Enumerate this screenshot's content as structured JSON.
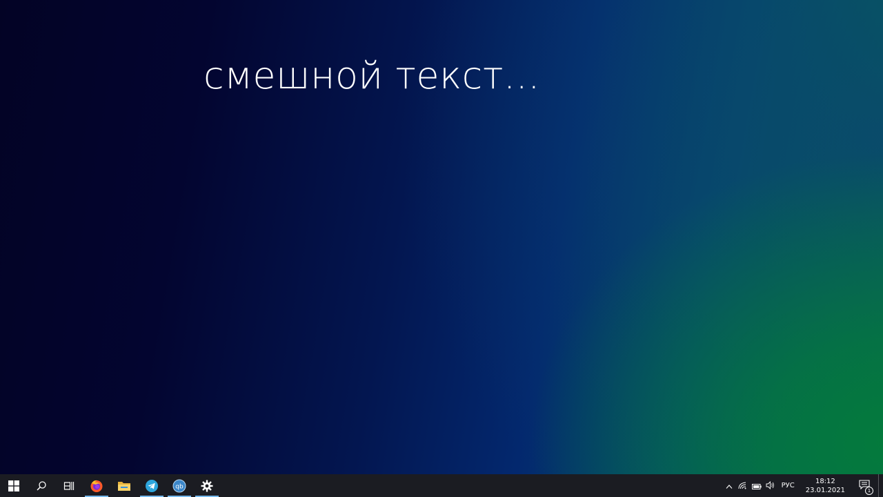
{
  "desktop": {
    "text": "смешной текст..."
  },
  "taskbar": {
    "start_icon": "windows-icon",
    "search_icon": "search-icon",
    "task_view_icon": "task-view-icon",
    "pinned_apps": [
      {
        "name": "firefox",
        "icon": "firefox-icon",
        "active": true
      },
      {
        "name": "file-explorer",
        "icon": "folder-icon",
        "active": false
      },
      {
        "name": "telegram",
        "icon": "telegram-icon",
        "active": true
      },
      {
        "name": "qbittorrent",
        "icon": "qbittorrent-icon",
        "active": true,
        "glyph": "qb"
      },
      {
        "name": "settings",
        "icon": "gear-icon",
        "active": true
      }
    ],
    "accent_color": "#76b9ed",
    "background_color": "#1b1c22"
  },
  "tray": {
    "chevron_icon": "chevron-up-icon",
    "network_icon": "wifi-icon",
    "battery_icon": "battery-icon",
    "volume_icon": "speaker-icon",
    "language": "РУС",
    "time": "18:12",
    "date": "23.01.2021",
    "notifications_icon": "action-center-icon",
    "notification_count": "1"
  }
}
